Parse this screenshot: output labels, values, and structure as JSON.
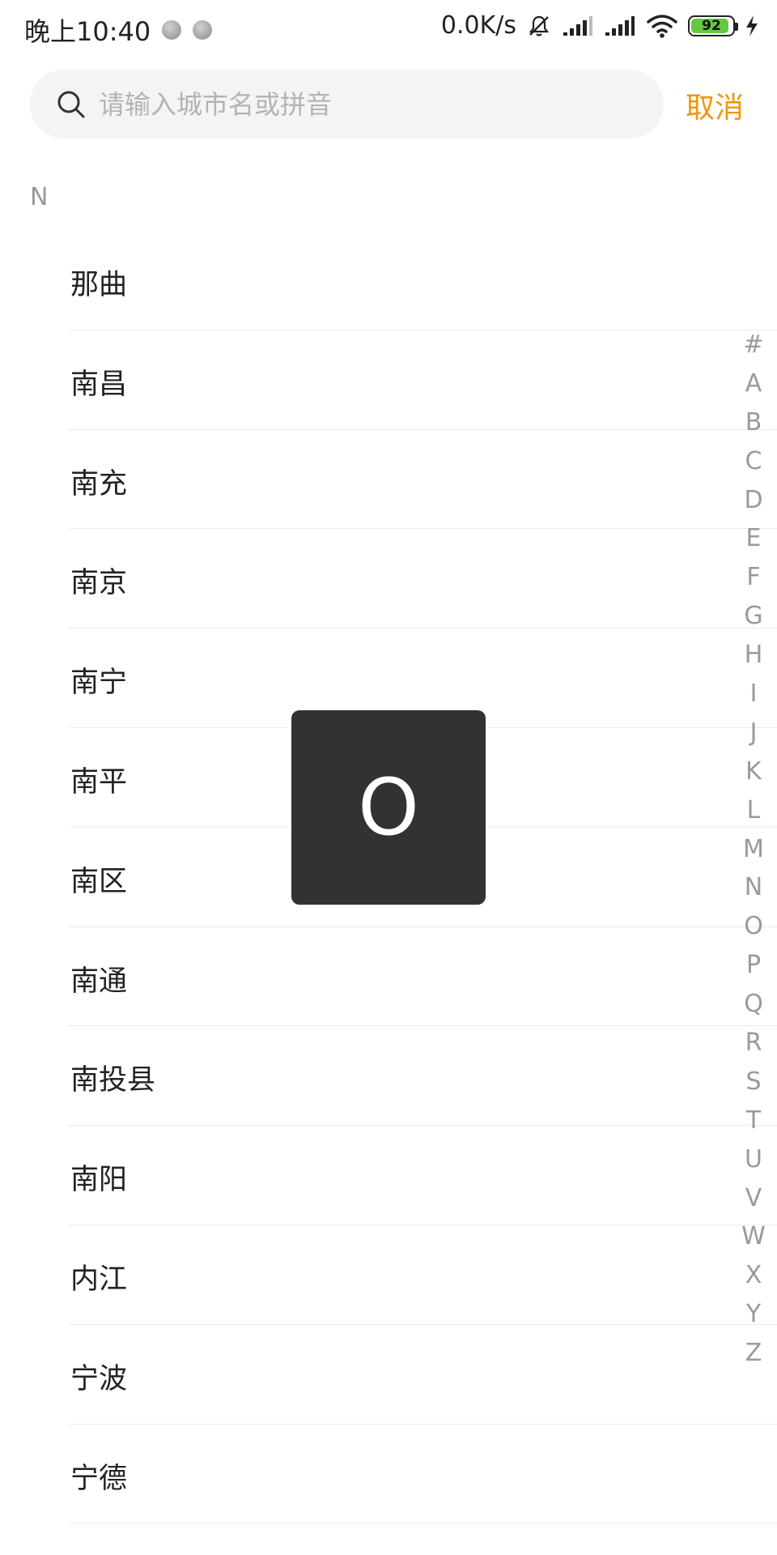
{
  "status_bar": {
    "time": "晚上10:40",
    "speed": "0.0K/s",
    "battery": "92",
    "battery_level": 0.92
  },
  "search": {
    "placeholder": "请输入城市名或拼音",
    "value": "",
    "cancel_label": "取消"
  },
  "section": {
    "letter": "N"
  },
  "cities": [
    "那曲",
    "南昌",
    "南充",
    "南京",
    "南宁",
    "南平",
    "南区",
    "南通",
    "南投县",
    "南阳",
    "内江",
    "宁波",
    "宁德"
  ],
  "index_letters": [
    "#",
    "A",
    "B",
    "C",
    "D",
    "E",
    "F",
    "G",
    "H",
    "I",
    "J",
    "K",
    "L",
    "M",
    "N",
    "O",
    "P",
    "Q",
    "R",
    "S",
    "T",
    "U",
    "V",
    "W",
    "X",
    "Y",
    "Z"
  ],
  "overlay": {
    "letter": "O"
  },
  "colors": {
    "accent": "#f0960f",
    "overlay_bg": "#323232",
    "index_text": "#9a9a9a"
  }
}
